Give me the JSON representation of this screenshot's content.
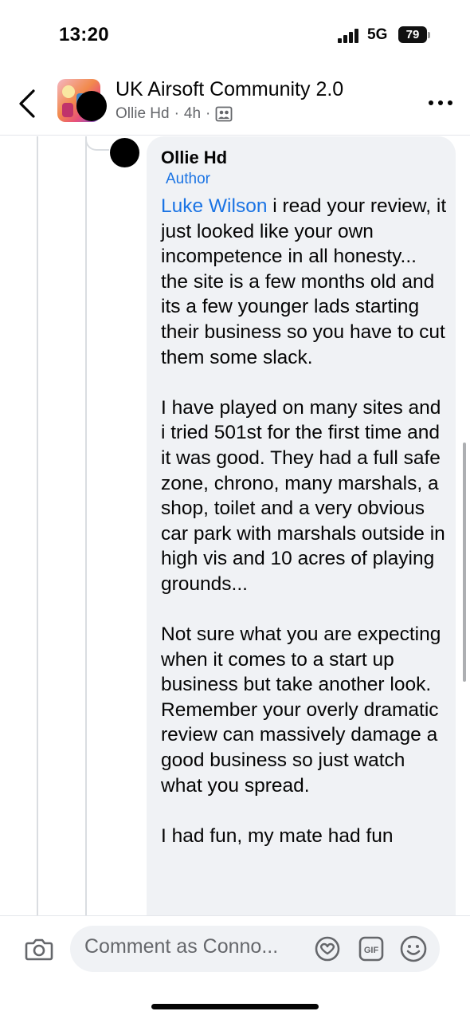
{
  "status_bar": {
    "time": "13:20",
    "network": "5G",
    "battery": "79"
  },
  "header": {
    "group_name": "UK Airsoft Community 2.0",
    "poster_name": "Ollie Hd",
    "separator": "·",
    "post_age": "4h",
    "icons": {
      "back": "chevron-left-icon",
      "audience": "group-members-icon",
      "more": "more-options-icon"
    }
  },
  "comment": {
    "author": "Ollie Hd",
    "badge": "Author",
    "mention": "Luke Wilson",
    "paragraph1_rest": " i read your review, it just looked like your own incompetence in all honesty... the site is a few months old and its a few younger lads starting their business so you have to cut them some slack.",
    "paragraph2": "I have played on many sites and i tried 501st for the first time and it was good. They had a full safe zone, chrono, many marshals, a shop, toilet and a very obvious car park with marshals outside in high vis and 10 acres of playing grounds...",
    "paragraph3": "Not sure what you are expecting when it comes to a start up business but take another look. Remember your overly dramatic review can massively damage a good business so just watch what you spread.",
    "paragraph4": "I had fun, my mate had fun"
  },
  "composer": {
    "placeholder": "Comment as Conno...",
    "icons": {
      "camera": "camera-icon",
      "sticker": "sticker-icon",
      "gif": "gif-icon",
      "emoji": "emoji-icon"
    }
  },
  "colors": {
    "link_blue": "#1b74e4",
    "bubble_bg": "#f0f2f5",
    "secondary_text": "#65676b"
  }
}
